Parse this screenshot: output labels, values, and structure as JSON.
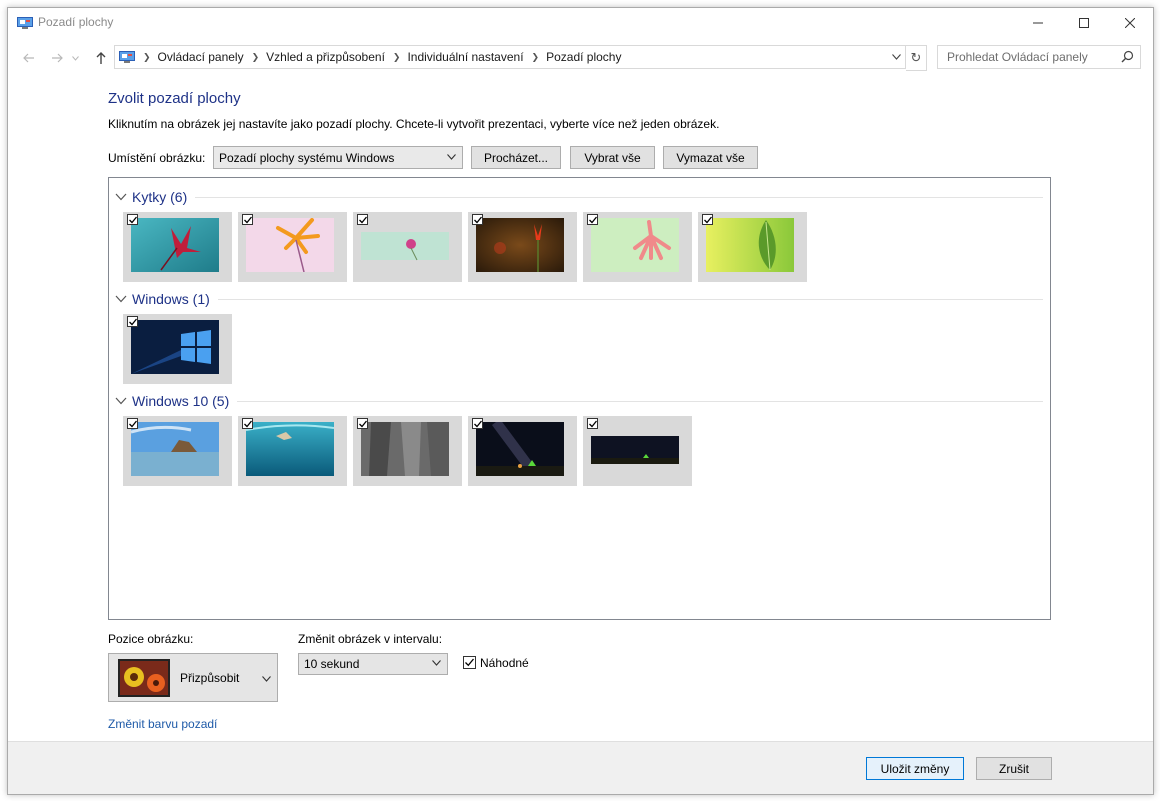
{
  "window": {
    "title": "Pozadí plochy"
  },
  "address": {
    "crumbs": [
      "Ovládací panely",
      "Vzhled a přizpůsobení",
      "Individuální nastavení",
      "Pozadí plochy"
    ]
  },
  "search": {
    "placeholder": "Prohledat Ovládací panely"
  },
  "main": {
    "heading": "Zvolit pozadí plochy",
    "description": "Kliknutím na obrázek jej nastavíte jako pozadí plochy. Chcete-li vytvořit prezentaci, vyberte více než jeden obrázek.",
    "location_label": "Umístění obrázku:",
    "location_value": "Pozadí plochy systému Windows",
    "browse_label": "Procházet...",
    "select_all_label": "Vybrat vše",
    "clear_all_label": "Vymazat vše"
  },
  "groups": [
    {
      "title": "Kytky (6)",
      "images": [
        {
          "name": "flower-1",
          "checked": true
        },
        {
          "name": "flower-2",
          "checked": true
        },
        {
          "name": "flower-3",
          "checked": true
        },
        {
          "name": "flower-4",
          "checked": true
        },
        {
          "name": "flower-5",
          "checked": true
        },
        {
          "name": "flower-6",
          "checked": true
        }
      ]
    },
    {
      "title": "Windows (1)",
      "images": [
        {
          "name": "windows-logo",
          "checked": true
        }
      ]
    },
    {
      "title": "Windows 10 (5)",
      "images": [
        {
          "name": "beach",
          "checked": true
        },
        {
          "name": "underwater",
          "checked": true
        },
        {
          "name": "rock",
          "checked": true
        },
        {
          "name": "milky-way-tent",
          "checked": true
        },
        {
          "name": "night-sky-wide",
          "checked": true
        }
      ]
    }
  ],
  "bottom": {
    "position_label": "Pozice obrázku:",
    "position_value": "Přizpůsobit",
    "interval_label": "Změnit obrázek v intervalu:",
    "interval_value": "10 sekund",
    "shuffle_label": "Náhodné",
    "shuffle_checked": true,
    "change_color_link": "Změnit barvu pozadí"
  },
  "footer": {
    "save_label": "Uložit změny",
    "cancel_label": "Zrušit"
  },
  "colors": {
    "heading": "#1e3287",
    "link": "#1e5aa8",
    "default_button_border": "#0078d7"
  }
}
